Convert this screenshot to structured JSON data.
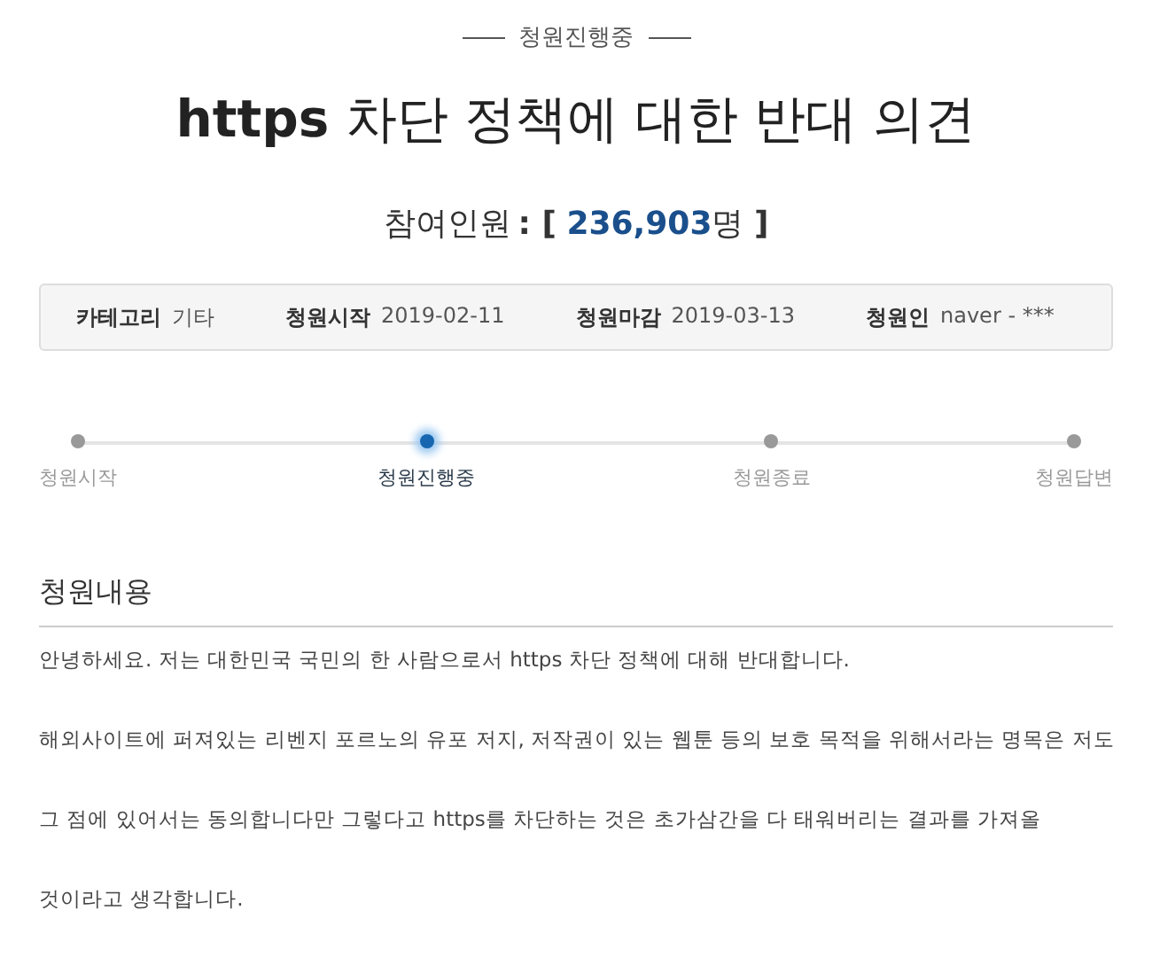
{
  "status_label": "청원진행중",
  "title": "**https** 차단 정책에 대한 반대 의견",
  "participants": {
    "label": "참여인원",
    "open": ": [",
    "count": "236,903",
    "unit": "명",
    "close": "]"
  },
  "info": [
    {
      "label": "카테고리",
      "value": "기타"
    },
    {
      "label": "청원시작",
      "value": "2019-02-11"
    },
    {
      "label": "청원마감",
      "value": "2019-03-13"
    },
    {
      "label": "청원인",
      "value": "naver - ***"
    }
  ],
  "steps": [
    {
      "label": "청원시작",
      "selected": false
    },
    {
      "label": "청원진행중",
      "selected": true
    },
    {
      "label": "청원종료",
      "selected": false
    },
    {
      "label": "청원답변",
      "selected": false
    }
  ],
  "content": {
    "heading": "청원내용",
    "paragraphs": [
      "안녕하세요. 저는 대한민국 국민의 한 사람으로서 https 차단 정책에 대해 반대합니다.",
      "해외사이트에 퍼져있는 리벤지 포르노의 유포 저지, 저작권이 있는 웹툰 등의 보호 목적을 위해서라는 명목은 저도",
      "그 점에 있어서는 동의합니다만 그렇다고 https를 차단하는 것은 초가삼간을 다 태워버리는 결과를 가져올",
      "것이라고 생각합니다."
    ]
  }
}
